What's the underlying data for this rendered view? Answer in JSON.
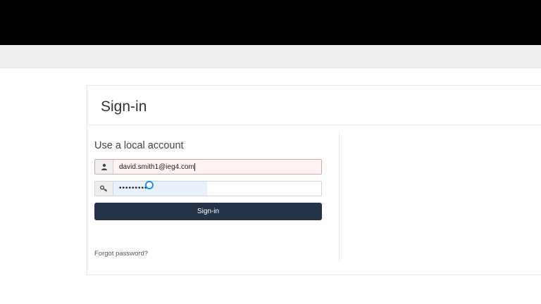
{
  "login": {
    "title": "Sign-in",
    "subtitle": "Use a local account",
    "email_value": "david.smith1@ieg4.com",
    "password_mask": "•••••••••",
    "signin_label": "Sign-in",
    "forgot_label": "Forgot password?"
  },
  "icons": {
    "email_addon": "user-icon",
    "password_addon": "key-icon"
  },
  "colors": {
    "header_bar": "#000000",
    "button_bg": "#24324a",
    "email_autofill_bg": "#fff4f3",
    "password_autofill_bg": "#e8f0fe"
  }
}
